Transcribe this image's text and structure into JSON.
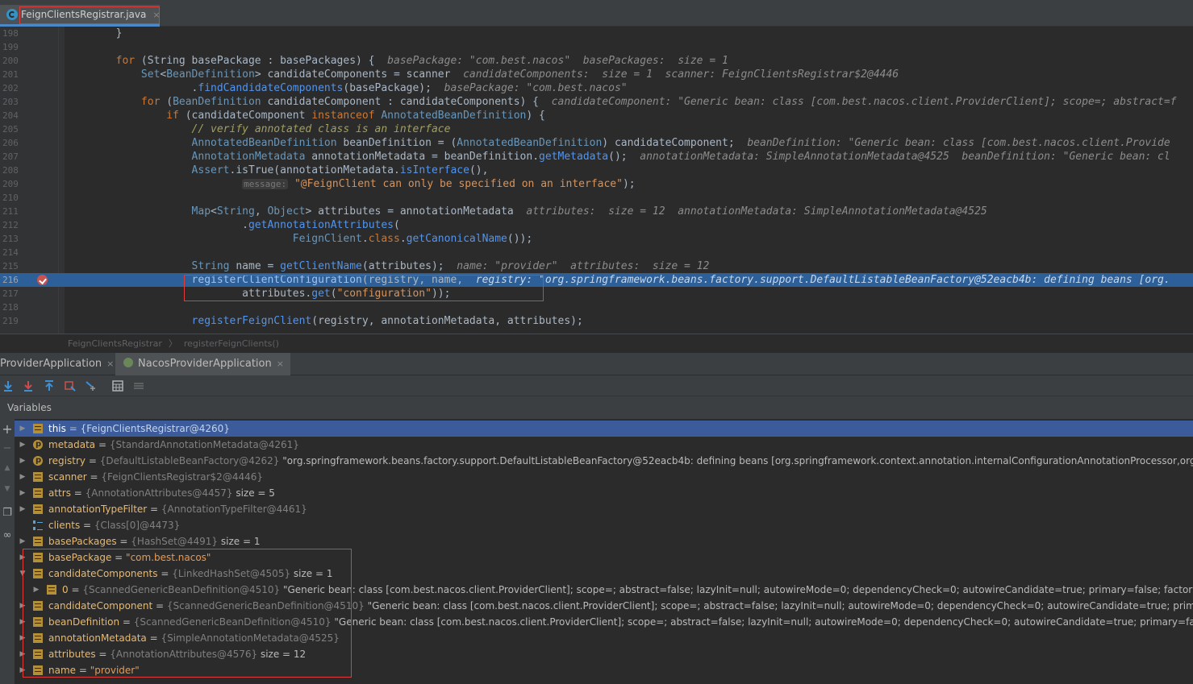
{
  "tab": {
    "filename": "FeignClientsRegistrar.java",
    "close": "×"
  },
  "editor": {
    "lines": [
      {
        "n": "198",
        "code": [
          {
            "c": "        }",
            "k": ""
          }
        ]
      },
      {
        "n": "199",
        "code": []
      },
      {
        "n": "200",
        "code": [
          {
            "c": "        for ",
            "k": "k"
          },
          {
            "c": "(String basePackage : basePackages) {  ",
            "k": ""
          },
          {
            "c": "basePackage: \"com.best.nacos\"  basePackages:  size = 1",
            "k": "h"
          }
        ]
      },
      {
        "n": "201",
        "code": [
          {
            "c": "            ",
            "k": ""
          },
          {
            "c": "Set",
            "k": "t"
          },
          {
            "c": "<",
            "k": ""
          },
          {
            "c": "BeanDefinition",
            "k": "t"
          },
          {
            "c": "> candidateComponents = scanner  ",
            "k": ""
          },
          {
            "c": "candidateComponents:  size = 1  scanner: FeignClientsRegistrar$2@4446",
            "k": "h"
          }
        ]
      },
      {
        "n": "202",
        "code": [
          {
            "c": "                    .",
            "k": ""
          },
          {
            "c": "findCandidateComponents",
            "k": "m"
          },
          {
            "c": "(basePackage);  ",
            "k": ""
          },
          {
            "c": "basePackage: \"com.best.nacos\"",
            "k": "h"
          }
        ]
      },
      {
        "n": "203",
        "code": [
          {
            "c": "            for ",
            "k": "k"
          },
          {
            "c": "(",
            "k": ""
          },
          {
            "c": "BeanDefinition",
            "k": "t"
          },
          {
            "c": " candidateComponent : candidateComponents) {  ",
            "k": ""
          },
          {
            "c": "candidateComponent: \"Generic bean: class [com.best.nacos.client.ProviderClient]; scope=; abstract=f",
            "k": "h"
          }
        ]
      },
      {
        "n": "204",
        "code": [
          {
            "c": "                if ",
            "k": "k"
          },
          {
            "c": "(candidateComponent ",
            "k": ""
          },
          {
            "c": "instanceof ",
            "k": "k"
          },
          {
            "c": "AnnotatedBeanDefinition",
            "k": "t"
          },
          {
            "c": ") {",
            "k": ""
          }
        ]
      },
      {
        "n": "205",
        "code": [
          {
            "c": "                    ",
            "k": ""
          },
          {
            "c": "// verify annotated class is an interface",
            "k": "cmy"
          }
        ]
      },
      {
        "n": "206",
        "code": [
          {
            "c": "                    ",
            "k": ""
          },
          {
            "c": "AnnotatedBeanDefinition",
            "k": "t"
          },
          {
            "c": " beanDefinition = (",
            "k": ""
          },
          {
            "c": "AnnotatedBeanDefinition",
            "k": "t"
          },
          {
            "c": ") candidateComponent;  ",
            "k": ""
          },
          {
            "c": "beanDefinition: \"Generic bean: class [com.best.nacos.client.Provide",
            "k": "h"
          }
        ]
      },
      {
        "n": "207",
        "code": [
          {
            "c": "                    ",
            "k": ""
          },
          {
            "c": "AnnotationMetadata",
            "k": "t"
          },
          {
            "c": " annotationMetadata = beanDefinition.",
            "k": ""
          },
          {
            "c": "getMetadata",
            "k": "m"
          },
          {
            "c": "();  ",
            "k": ""
          },
          {
            "c": "annotationMetadata: SimpleAnnotationMetadata@4525  beanDefinition: \"Generic bean: cl",
            "k": "h"
          }
        ]
      },
      {
        "n": "208",
        "code": [
          {
            "c": "                    ",
            "k": ""
          },
          {
            "c": "Assert",
            "k": "t"
          },
          {
            "c": ".isTrue(annotationMetadata.",
            "k": ""
          },
          {
            "c": "isInterface",
            "k": "m"
          },
          {
            "c": "(),",
            "k": ""
          }
        ]
      },
      {
        "n": "209",
        "code": [
          {
            "c": "                            ",
            "k": ""
          },
          {
            "c": "message:",
            "k": "hint"
          },
          {
            "c": " ",
            "k": ""
          },
          {
            "c": "\"@FeignClient can only be specified on an interface\"",
            "k": "str"
          },
          {
            "c": ");",
            "k": ""
          }
        ]
      },
      {
        "n": "210",
        "code": []
      },
      {
        "n": "211",
        "code": [
          {
            "c": "                    ",
            "k": ""
          },
          {
            "c": "Map",
            "k": "t"
          },
          {
            "c": "<",
            "k": ""
          },
          {
            "c": "String",
            "k": "t"
          },
          {
            "c": ", ",
            "k": ""
          },
          {
            "c": "Object",
            "k": "t"
          },
          {
            "c": "> attributes = annotationMetadata  ",
            "k": ""
          },
          {
            "c": "attributes:  size = 12  annotationMetadata: SimpleAnnotationMetadata@4525",
            "k": "h"
          }
        ]
      },
      {
        "n": "212",
        "code": [
          {
            "c": "                            .",
            "k": ""
          },
          {
            "c": "getAnnotationAttributes",
            "k": "m"
          },
          {
            "c": "(",
            "k": ""
          }
        ]
      },
      {
        "n": "213",
        "code": [
          {
            "c": "                                    ",
            "k": ""
          },
          {
            "c": "FeignClient",
            "k": "t"
          },
          {
            "c": ".",
            "k": ""
          },
          {
            "c": "class",
            "k": "k"
          },
          {
            "c": ".",
            "k": ""
          },
          {
            "c": "getCanonicalName",
            "k": "m"
          },
          {
            "c": "());",
            "k": ""
          }
        ]
      },
      {
        "n": "214",
        "code": []
      },
      {
        "n": "215",
        "code": [
          {
            "c": "                    ",
            "k": ""
          },
          {
            "c": "String",
            "k": "t"
          },
          {
            "c": " name = ",
            "k": ""
          },
          {
            "c": "getClientName",
            "k": "m"
          },
          {
            "c": "(attributes);  ",
            "k": ""
          },
          {
            "c": "name: \"provider\"  attributes:  size = 12",
            "k": "h"
          }
        ]
      },
      {
        "n": "216",
        "hl": true,
        "code": [
          {
            "c": "                    ",
            "k": ""
          },
          {
            "c": "registerClientConfiguration",
            "k": "m"
          },
          {
            "c": "(registry, name,  ",
            "k": ""
          },
          {
            "c": "registry: \"org.springframework.beans.factory.support.DefaultListableBeanFactory@52eacb4b: defining beans [org.",
            "k": "h"
          }
        ]
      },
      {
        "n": "217",
        "code": [
          {
            "c": "                            attributes.",
            "k": ""
          },
          {
            "c": "get",
            "k": "m"
          },
          {
            "c": "(",
            "k": ""
          },
          {
            "c": "\"configuration\"",
            "k": "str"
          },
          {
            "c": "));",
            "k": ""
          }
        ]
      },
      {
        "n": "218",
        "code": []
      },
      {
        "n": "219",
        "code": [
          {
            "c": "                    ",
            "k": ""
          },
          {
            "c": "registerFeignClient",
            "k": "m"
          },
          {
            "c": "(registry, annotationMetadata, attributes);",
            "k": ""
          }
        ]
      }
    ]
  },
  "breadcrumb": {
    "class_name": "FeignClientsRegistrar",
    "method": "registerFeignClients()",
    "sep": "〉"
  },
  "debug_tabs": [
    {
      "label": "ProviderApplication",
      "close": "×"
    },
    {
      "label": "NacosProviderApplication",
      "close": "×"
    }
  ],
  "variables": {
    "title": "Variables",
    "rows": [
      {
        "icon": "field",
        "name": "this",
        "type": "{FeignClientsRegistrar@4260}",
        "value": "",
        "sel": true,
        "tri": "▶"
      },
      {
        "icon": "param",
        "name": "metadata",
        "type": "{StandardAnnotationMetadata@4261}",
        "value": "",
        "tri": "▶"
      },
      {
        "icon": "param",
        "name": "registry",
        "type": "{DefaultListableBeanFactory@4262}",
        "value": "\"org.springframework.beans.factory.support.DefaultListableBeanFactory@52eacb4b: defining beans [org.springframework.context.annotation.internalConfigurationAnnotationProcessor,org.springfra",
        "tri": "▶"
      },
      {
        "icon": "field",
        "name": "scanner",
        "type": "{FeignClientsRegistrar$2@4446}",
        "value": "",
        "tri": "▶"
      },
      {
        "icon": "field",
        "name": "attrs",
        "type": "{AnnotationAttributes@4457}",
        "value": "size = 5",
        "tri": "▶"
      },
      {
        "icon": "field",
        "name": "annotationTypeFilter",
        "type": "{AnnotationTypeFilter@4461}",
        "value": "",
        "tri": "▶"
      },
      {
        "icon": "list",
        "name": "clients",
        "type": "{Class[0]@4473}",
        "value": "",
        "tri": ""
      },
      {
        "icon": "field",
        "name": "basePackages",
        "type": "{HashSet@4491}",
        "value": "size = 1",
        "tri": "▶"
      },
      {
        "icon": "field",
        "name": "basePackage",
        "type": "",
        "value": "",
        "str": "\"com.best.nacos\"",
        "tri": "▶"
      },
      {
        "icon": "field",
        "name": "candidateComponents",
        "type": "{LinkedHashSet@4505}",
        "value": "size = 1",
        "tri": "▼"
      },
      {
        "icon": "field",
        "name": "0",
        "type": "{ScannedGenericBeanDefinition@4510}",
        "value": "\"Generic bean: class [com.best.nacos.client.ProviderClient]; scope=; abstract=false; lazyInit=null; autowireMode=0; dependencyCheck=0; autowireCandidate=true; primary=false; factoryBeanName=n",
        "tri": "▶",
        "indent": true
      },
      {
        "icon": "field",
        "name": "candidateComponent",
        "type": "{ScannedGenericBeanDefinition@4510}",
        "value": "\"Generic bean: class [com.best.nacos.client.ProviderClient]; scope=; abstract=false; lazyInit=null; autowireMode=0; dependencyCheck=0; autowireCandidate=true; primary=false; fac",
        "tri": "▶"
      },
      {
        "icon": "field",
        "name": "beanDefinition",
        "type": "{ScannedGenericBeanDefinition@4510}",
        "value": "\"Generic bean: class [com.best.nacos.client.ProviderClient]; scope=; abstract=false; lazyInit=null; autowireMode=0; dependencyCheck=0; autowireCandidate=true; primary=false; factoryBe",
        "tri": "▶"
      },
      {
        "icon": "field",
        "name": "annotationMetadata",
        "type": "{SimpleAnnotationMetadata@4525}",
        "value": "",
        "tri": "▶"
      },
      {
        "icon": "field",
        "name": "attributes",
        "type": "{AnnotationAttributes@4576}",
        "value": "size = 12",
        "tri": "▶"
      },
      {
        "icon": "field",
        "name": "name",
        "type": "",
        "value": "",
        "str": "\"provider\"",
        "tri": "▶"
      }
    ]
  },
  "colors": {
    "accent": "#4a88c7",
    "highlight_line": "#2d6099",
    "selection": "#3b5b9a",
    "annotation_box": "#e03c3c"
  }
}
